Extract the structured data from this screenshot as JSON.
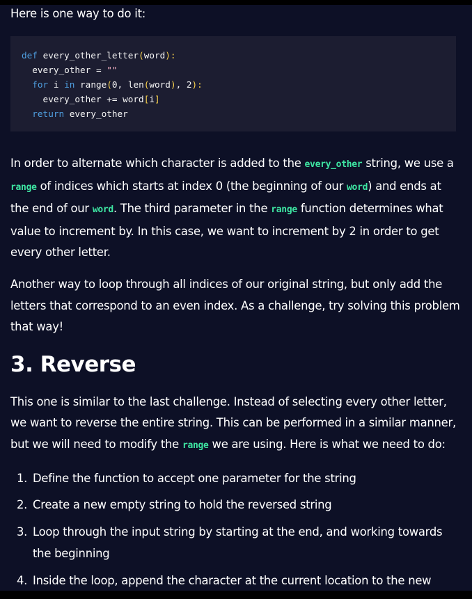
{
  "intro": "Here is one way to do it:",
  "code_lines": [
    [
      {
        "t": "def ",
        "c": "kw"
      },
      {
        "t": "every_other_letter",
        "c": "fn"
      },
      {
        "t": "(",
        "c": "pc"
      },
      {
        "t": "word",
        "c": "fn"
      },
      {
        "t": "):",
        "c": "pc"
      }
    ],
    [
      {
        "t": "  every_other = ",
        "c": "fn"
      },
      {
        "t": "\"\"",
        "c": "st"
      }
    ],
    [
      {
        "t": "  ",
        "c": "fn"
      },
      {
        "t": "for ",
        "c": "kw"
      },
      {
        "t": "i ",
        "c": "fn"
      },
      {
        "t": "in ",
        "c": "kw"
      },
      {
        "t": "range",
        "c": "fn"
      },
      {
        "t": "(",
        "c": "pc"
      },
      {
        "t": "0",
        "c": "nm"
      },
      {
        "t": ", ",
        "c": "fn"
      },
      {
        "t": "len",
        "c": "fn"
      },
      {
        "t": "(",
        "c": "pc"
      },
      {
        "t": "word",
        "c": "fn"
      },
      {
        "t": ")",
        "c": "pc"
      },
      {
        "t": ", 2",
        "c": "fn"
      },
      {
        "t": "):",
        "c": "pc"
      }
    ],
    [
      {
        "t": "    every_other += word",
        "c": "fn"
      },
      {
        "t": "[",
        "c": "pc"
      },
      {
        "t": "i",
        "c": "fn"
      },
      {
        "t": "]",
        "c": "pc"
      }
    ],
    [
      {
        "t": "  ",
        "c": "fn"
      },
      {
        "t": "return ",
        "c": "kw"
      },
      {
        "t": "every_other",
        "c": "fn"
      }
    ]
  ],
  "para1": [
    {
      "t": "In order to alternate which character is added to the "
    },
    {
      "t": "every_other",
      "code": true
    },
    {
      "t": " string, we use a "
    },
    {
      "t": "range",
      "code": true
    },
    {
      "t": " of indices which starts at index 0 (the beginning of our "
    },
    {
      "t": "word",
      "code": true
    },
    {
      "t": ") and ends at the end of our "
    },
    {
      "t": "word",
      "code": true
    },
    {
      "t": ". The third parameter in the "
    },
    {
      "t": "range",
      "code": true
    },
    {
      "t": " function determines what value to increment by. In this case, we want to increment by 2 in order to get every other letter."
    }
  ],
  "para2": "Another way to loop through all indices of our original string, but only add the letters that correspond to an even index. As a challenge, try solving this problem that way!",
  "heading": "3. Reverse",
  "para3": [
    {
      "t": "This one is similar to the last challenge. Instead of selecting every other letter, we want to reverse the entire string. This can be performed in a similar manner, but we will need to modify the "
    },
    {
      "t": "range",
      "code": true
    },
    {
      "t": " we are using. Here is what we need to do:"
    }
  ],
  "steps": [
    {
      "num": "1.",
      "text": "Define the function to accept one parameter for the string"
    },
    {
      "num": "2.",
      "text": "Create a new empty string to hold the reversed string"
    },
    {
      "num": "3.",
      "text": "Loop through the input string by starting at the end, and working towards the beginning"
    },
    {
      "num": "4.",
      "text": "Inside the loop, append the character at the current location to the new"
    }
  ],
  "colors": {
    "background": "#0d1026",
    "code_background": "#1c1d31",
    "inline_code": "#3ee6a3",
    "keyword": "#4f9fe0",
    "punctuation": "#fcd34d",
    "string": "#fdb6c8"
  }
}
